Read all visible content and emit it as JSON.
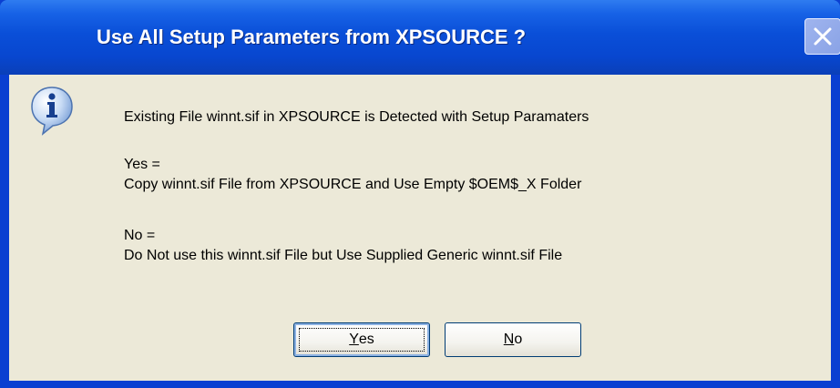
{
  "window": {
    "title": "Use All Setup Parameters from XPSOURCE ?",
    "close_icon": "close-icon"
  },
  "message": {
    "icon": "info-icon",
    "line1": "Existing File winnt.sif in XPSOURCE is Detected with Setup Paramaters",
    "yes_label": "Yes =",
    "yes_desc": "Copy winnt.sif File from XPSOURCE and Use Empty $OEM$_X Folder",
    "no_label": "No  =",
    "no_desc": "Do Not use this winnt.sif File but Use Supplied Generic winnt.sif File"
  },
  "buttons": {
    "yes_accel": "Y",
    "yes_rest": "es",
    "no_accel": "N",
    "no_rest": "o"
  },
  "colors": {
    "titlebar": "#0a4fd8",
    "client": "#ece9d8",
    "button_border": "#003c74"
  }
}
